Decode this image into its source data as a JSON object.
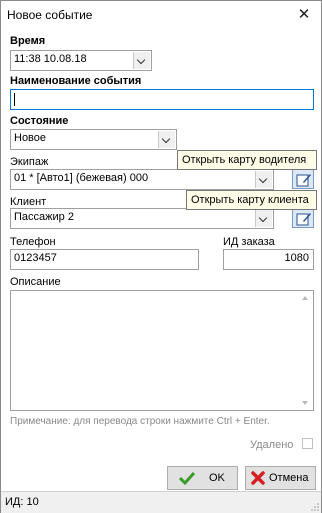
{
  "window": {
    "title": "Новое событие"
  },
  "fields": {
    "time": {
      "label": "Время",
      "value": "11:38 10.08.18"
    },
    "event_name": {
      "label": "Наименование события",
      "value": ""
    },
    "state": {
      "label": "Состояние",
      "value": "Новое"
    },
    "crew": {
      "label": "Экипаж",
      "value": "01 * [Авто1] (бежевая) 000"
    },
    "client": {
      "label": "Клиент",
      "value": "Пассажир 2"
    },
    "phone": {
      "label": "Телефон",
      "value": "0123457"
    },
    "order_id": {
      "label": "ИД заказа",
      "value": "1080"
    },
    "description": {
      "label": "Описание",
      "value": ""
    }
  },
  "tooltips": {
    "driver_map": "Открыть карту водителя",
    "client_map": "Открыть карту клиента"
  },
  "hint": "Примечание: для перевода строки нажмите Ctrl + Enter.",
  "deleted": {
    "label": "Удалено",
    "checked": false
  },
  "buttons": {
    "ok": "OK",
    "cancel": "Отмена"
  },
  "status": {
    "id_text": "ИД: 10"
  },
  "icons": {
    "close": "close-icon",
    "ok": "checkmark-icon",
    "cancel": "red-x-icon",
    "map": "map-edit-icon"
  }
}
